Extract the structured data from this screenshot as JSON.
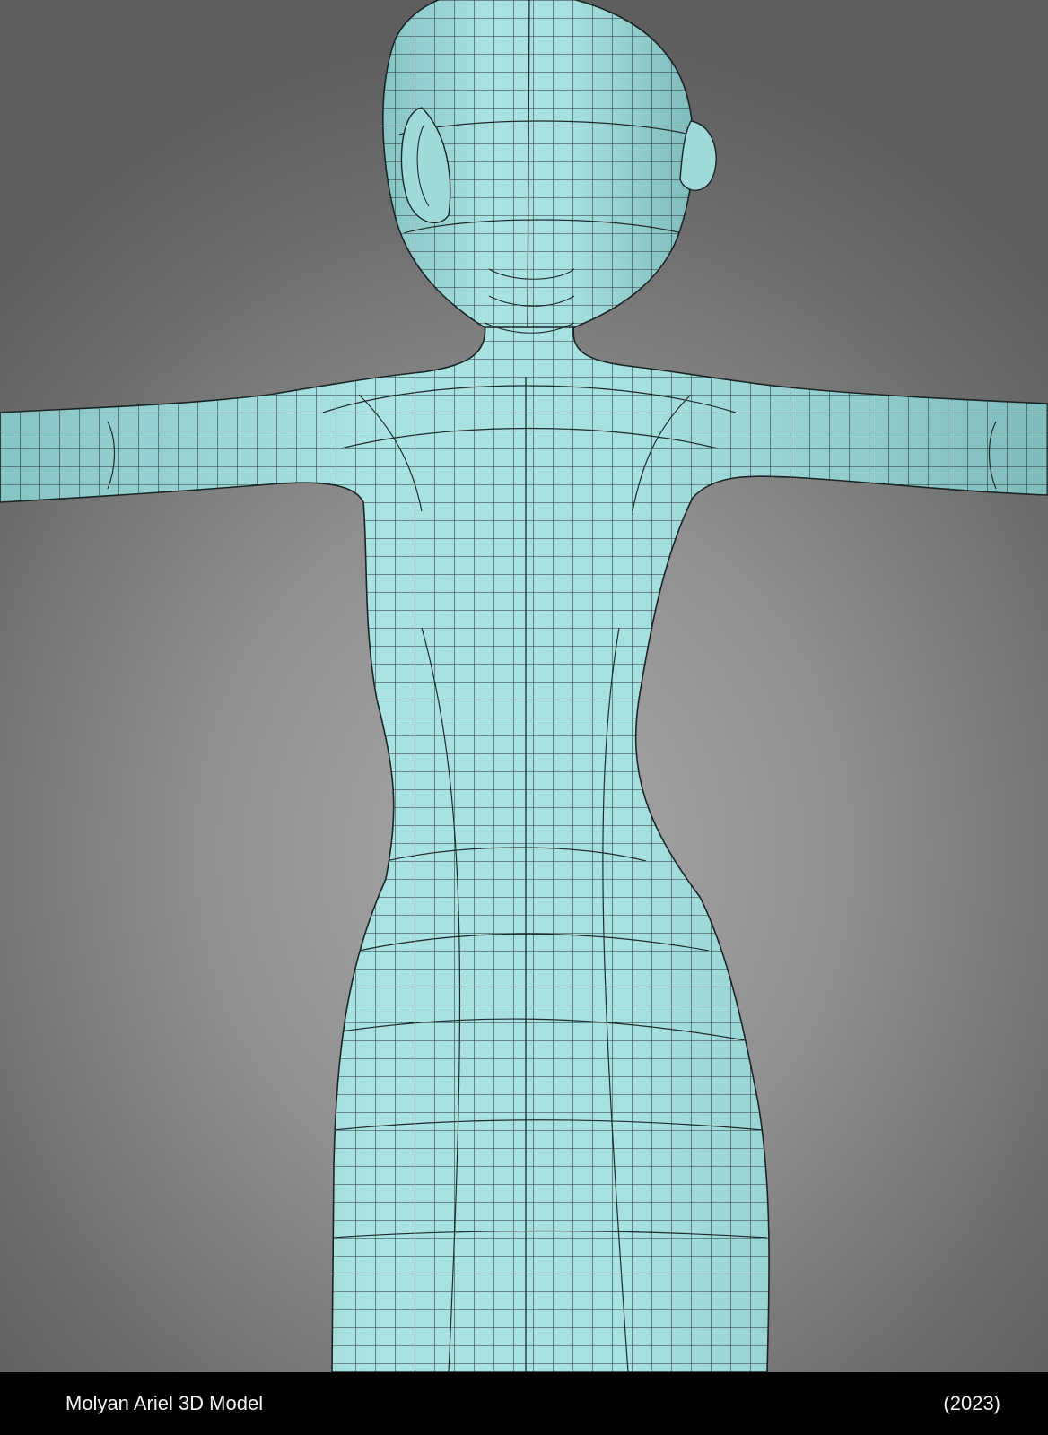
{
  "render": {
    "subject": "3d-model-wireframe",
    "mesh_color": "#a6e0df",
    "wire_color": "#1e2b2b",
    "background_color": "#8f8f8f"
  },
  "caption": {
    "title": "Molyan Ariel 3D Model",
    "year": "(2023)"
  }
}
